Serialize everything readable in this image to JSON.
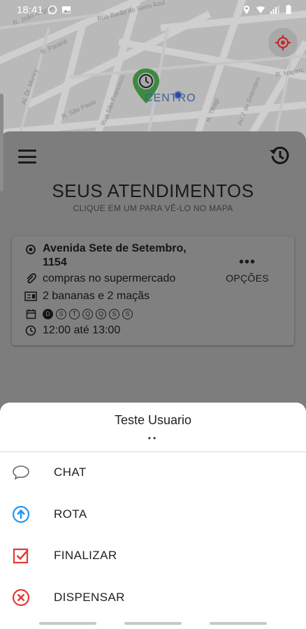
{
  "status_bar": {
    "time": "18:41"
  },
  "map": {
    "label": "CENTRO",
    "street_labels": [
      "R. João Négrão",
      "Rua Barão do Serro Azul",
      "R. Riachuelo",
      "R. Paraná",
      "Al. Dr. Muricy",
      "Rua São Francisco",
      "R. Tibagi",
      "Av. Sete de Setembro",
      "R. Saldanha Marinho"
    ]
  },
  "header": {
    "title": "SEUS ATENDIMENTOS",
    "subtitle": "CLIQUE EM UM PARA VÊ-LO NO MAPA"
  },
  "card": {
    "address": "Avenida Sete de Setembro, 1154",
    "description": "compras no supermercado",
    "items": "2 bananas e 2 maçãs",
    "days": [
      "D",
      "S",
      "T",
      "Q",
      "Q",
      "S",
      "S"
    ],
    "active_day_index": 0,
    "time": "12:00 até 13:00",
    "options_label": "OPÇÕES"
  },
  "sheet": {
    "title": "Teste Usuario",
    "actions": {
      "chat": "CHAT",
      "rota": "ROTA",
      "finalizar": "FINALIZAR",
      "dispensar": "DISPENSAR"
    }
  },
  "colors": {
    "accent_blue": "#2196f3",
    "accent_red": "#e53935",
    "pin_green": "#43a047"
  },
  "icons": {
    "chat": "chat-bubble-icon",
    "rota": "route-arrow-icon",
    "finalizar": "checkbox-icon",
    "dispensar": "cancel-circle-icon"
  }
}
